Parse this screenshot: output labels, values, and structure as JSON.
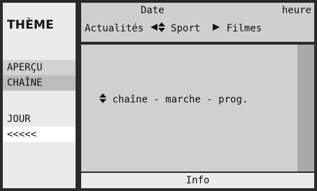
{
  "sidebar": {
    "title": "THÈME",
    "items": [
      {
        "label": "APERÇU"
      },
      {
        "label": "CHAÎNE"
      },
      {
        "label": "JOUR"
      },
      {
        "label": "<<<<<"
      }
    ]
  },
  "header": {
    "date_label": "Date",
    "heure_label": "heure",
    "categories": [
      "Actualités",
      "Sport",
      "Filmes"
    ]
  },
  "main": {
    "hint": "chaîne - marche - prog."
  },
  "footer": {
    "info_label": "Info"
  },
  "icons": {
    "left": "left-triangle-icon",
    "updown": "up-down-arrow-icon",
    "right": "right-triangle-icon"
  }
}
